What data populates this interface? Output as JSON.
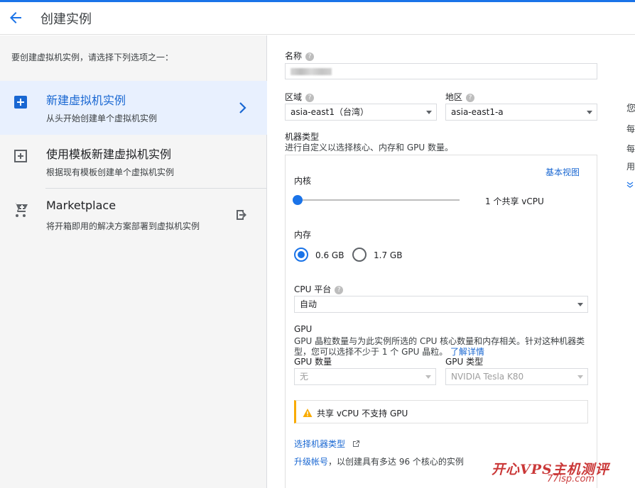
{
  "header": {
    "title": "创建实例"
  },
  "left": {
    "intro": "要创建虚拟机实例，请选择下列选项之一：",
    "options": [
      {
        "title": "新建虚拟机实例",
        "desc": "从头开始创建单个虚拟机实例",
        "icon": "add-box-icon"
      },
      {
        "title": "使用模板新建虚拟机实例",
        "desc": "根据现有模板创建单个虚拟机实例",
        "icon": "add-from-template-icon"
      },
      {
        "title": "Marketplace",
        "desc": "将开箱即用的解决方案部署到虚拟机实例",
        "icon": "cart-icon"
      }
    ]
  },
  "form": {
    "name_label": "名称",
    "region_label": "区域",
    "region_value": "asia-east1（台湾）",
    "zone_label": "地区",
    "zone_value": "asia-east1-a",
    "machine_type_label": "机器类型",
    "machine_type_desc": "进行自定义以选择核心、内存和 GPU 数量。",
    "basic_view_link": "基本视图",
    "cores_label": "内核",
    "cores_value": "1 个共享 vCPU",
    "cores_fraction": 0,
    "memory_label": "内存",
    "memory_options": [
      "0.6 GB",
      "1.7 GB"
    ],
    "memory_selected": "0.6 GB",
    "cpu_platform_label": "CPU 平台",
    "cpu_platform_value": "自动",
    "gpu_label": "GPU",
    "gpu_desc_1": "GPU 晶粒数量与为此实例所选的 CPU 核心数量和内存相关。针对这种机器类",
    "gpu_desc_2": "型，您可以选择不少于 1 个 GPU 晶粒。",
    "gpu_learn_more": "了解详情",
    "gpu_count_label": "GPU 数量",
    "gpu_count_value": "无",
    "gpu_type_label": "GPU 类型",
    "gpu_type_value": "NVIDIA Tesla K80",
    "warning_text": "共享 vCPU 不支持 GPU",
    "select_machine_type_link": "选择机器类型",
    "upgrade_link": "升级帐号",
    "upgrade_text": "，以创建具有多达 96 个核心的实例"
  },
  "right_panel": {
    "lines": [
      "您",
      "每",
      "每",
      "用"
    ]
  },
  "watermark": {
    "text": "开心VPS主机测评",
    "site": "77isp.com"
  },
  "colors": {
    "accent": "#1a73e8",
    "active_bg": "#e8f0fe",
    "warning": "#f9ab00"
  }
}
